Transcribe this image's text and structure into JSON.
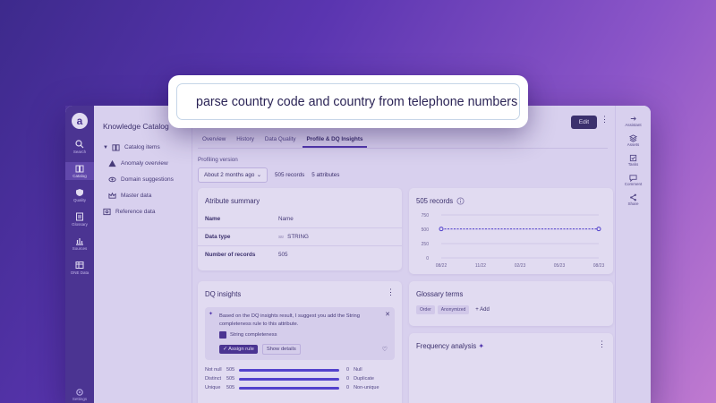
{
  "search": {
    "query": "parse country code and country from telephone numbers"
  },
  "rail": {
    "items": [
      {
        "label": "Search"
      },
      {
        "label": "Catalog"
      },
      {
        "label": "Quality"
      },
      {
        "label": "Glossary"
      },
      {
        "label": "Sources"
      },
      {
        "label": "ONE Data"
      }
    ],
    "bottom": "Settings"
  },
  "nav": {
    "title": "Knowledge Catalog",
    "items": [
      "Catalog items",
      "Anomaly overview",
      "Domain suggestions",
      "Master data",
      "Reference data"
    ]
  },
  "header": {
    "edit": "Edit"
  },
  "tabs": [
    "Overview",
    "History",
    "Data Quality",
    "Profile & DQ Insights"
  ],
  "profiling": {
    "label": "Profiling version",
    "selected": "About 2 months ago",
    "records": "505 records",
    "attributes": "5 attributes"
  },
  "attr_summary": {
    "title": "Atribute summary",
    "rows": [
      {
        "k": "Name",
        "v": "Name"
      },
      {
        "k": "Data type",
        "prefix": "Str",
        "v": "STRING"
      },
      {
        "k": "Number of records",
        "v": "505"
      }
    ]
  },
  "records_chart": {
    "title": "505 records",
    "yticks": [
      "750",
      "500",
      "250",
      "0"
    ],
    "xticks": [
      "08/22",
      "11/22",
      "02/23",
      "05/23",
      "08/23"
    ]
  },
  "chart_data": {
    "type": "line",
    "title": "505 records",
    "x": [
      "08/22",
      "08/23"
    ],
    "series": [
      {
        "values": [
          505,
          505
        ]
      }
    ],
    "ylim": [
      0,
      750
    ],
    "grid": true
  },
  "dq": {
    "title": "DQ insights",
    "message": "Based on the DQ insights result, I suggest you add the String completeness rule to this attribute.",
    "rule": "String completeness",
    "assign": "Assign rule",
    "details": "Show details",
    "bars": [
      {
        "label": "Not null",
        "left": "505",
        "right": "0",
        "rlabel": "Null"
      },
      {
        "label": "Distinct",
        "left": "505",
        "right": "0",
        "rlabel": "Duplicate"
      },
      {
        "label": "Unique",
        "left": "505",
        "right": "0",
        "rlabel": "Non-unique"
      }
    ]
  },
  "glossary": {
    "title": "Glossary terms",
    "tags": [
      "Order",
      "Anonymized"
    ],
    "add": "Add"
  },
  "frequency": {
    "title": "Frequency analysis"
  },
  "right_rail": [
    "Assistant",
    "Assets",
    "Tasks",
    "Comment",
    "Share"
  ],
  "colors": {
    "accent": "#4a2fa8",
    "rail": "#3f2a86"
  }
}
